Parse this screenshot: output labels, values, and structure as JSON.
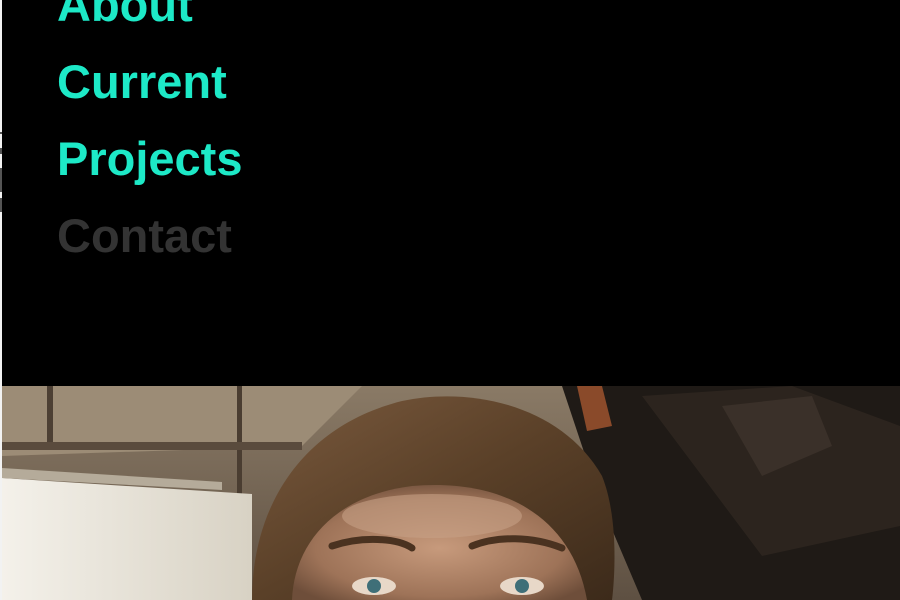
{
  "nav": {
    "items": [
      {
        "label": "About",
        "state": "default"
      },
      {
        "label": "Current",
        "state": "default"
      },
      {
        "label": "Projects",
        "state": "default"
      },
      {
        "label": "Contact",
        "state": "active"
      }
    ],
    "link_color": "#1de9c7",
    "active_color": "#333333",
    "background": "#000000"
  },
  "hero": {
    "image": "portrait-photo"
  }
}
